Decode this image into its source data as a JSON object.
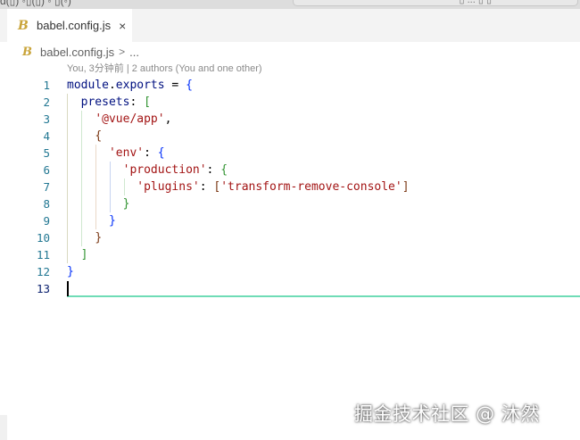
{
  "topbar": {
    "left_text": "ɑ(▯) ◦▯(▯) ◦ ▯(◦)",
    "search_text": "▯ ... ▯ ▯"
  },
  "tab": {
    "icon": "babel-icon",
    "label": "babel.config.js",
    "close_glyph": "×"
  },
  "breadcrumb": {
    "file": "babel.config.js",
    "separator": ">",
    "more": "..."
  },
  "blame": "You, 3分钟前 | 2 authors (You and one other)",
  "line_numbers": [
    "1",
    "2",
    "3",
    "4",
    "5",
    "6",
    "7",
    "8",
    "9",
    "10",
    "11",
    "12",
    "13"
  ],
  "code": {
    "l1": {
      "a": "module",
      "b": ".",
      "c": "exports",
      "d": " = ",
      "e": "{"
    },
    "l2": {
      "a": "presets",
      "b": ": ",
      "c": "["
    },
    "l3": {
      "a": "'@vue/app'",
      "b": ","
    },
    "l4": {
      "a": "{"
    },
    "l5": {
      "a": "'env'",
      "b": ": ",
      "c": "{"
    },
    "l6": {
      "a": "'production'",
      "b": ": ",
      "c": "{"
    },
    "l7": {
      "a": "'plugins'",
      "b": ": ",
      "c": "[",
      "d": "'transform-remove-console'",
      "e": "]"
    },
    "l8": {
      "a": "}"
    },
    "l9": {
      "a": "}"
    },
    "l10": {
      "a": "}"
    },
    "l11": {
      "a": "]"
    },
    "l12": {
      "a": "}"
    }
  },
  "watermark": "掘金技术社区 @ 沐然",
  "colors": {
    "accent_cursor_line": "#6fdcb6",
    "line_number": "#237893",
    "string": "#a31515",
    "identifier": "#001080"
  }
}
